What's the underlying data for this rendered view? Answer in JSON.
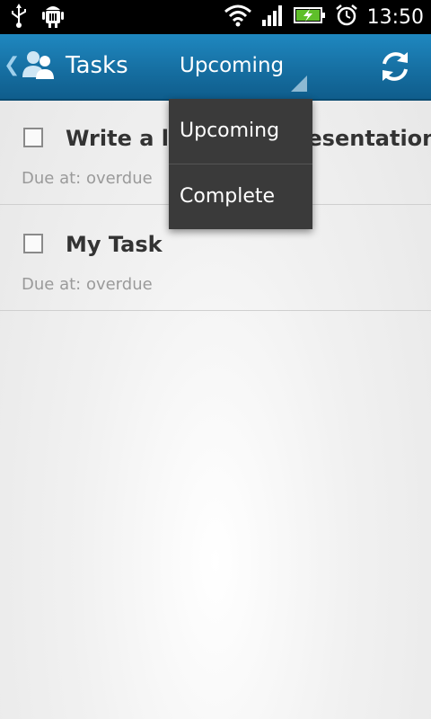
{
  "status_bar": {
    "time": "13:50",
    "icons": [
      "usb-icon",
      "android-debug-icon",
      "wifi-icon",
      "signal-icon",
      "battery-charging-icon",
      "alarm-icon"
    ]
  },
  "action_bar": {
    "title": "Tasks",
    "spinner_selected": "Upcoming",
    "icons": [
      "back-chevron-icon",
      "contacts-app-icon",
      "refresh-icon"
    ],
    "accent": "#166fa2"
  },
  "dropdown": {
    "options": [
      "Upcoming",
      "Complete"
    ]
  },
  "tasks": [
    {
      "title": "Write a long task presentation",
      "due": "Due at: overdue",
      "checked": false
    },
    {
      "title": "My Task",
      "due": "Due at: overdue",
      "checked": false
    }
  ]
}
